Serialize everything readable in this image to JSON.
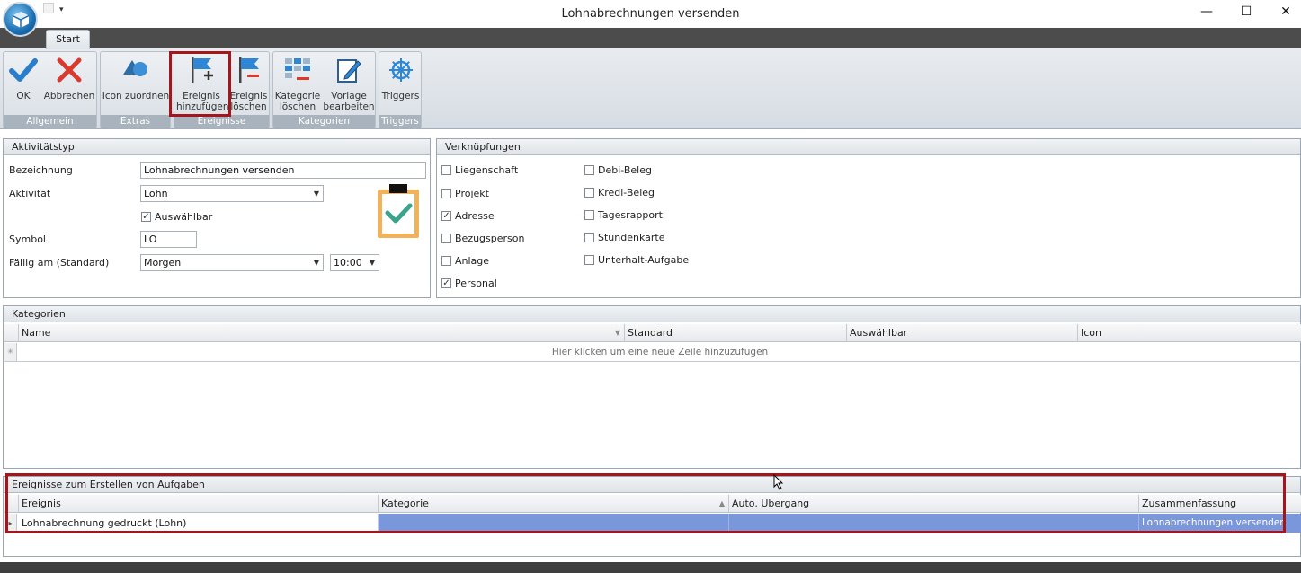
{
  "window": {
    "title": "Lohnabrechnungen versenden",
    "controls": {
      "minimize": "—",
      "maximize": "☐",
      "close": "✕"
    }
  },
  "ribbon": {
    "tab_start": "Start",
    "groups": {
      "allgemein": "Allgemein",
      "extras": "Extras",
      "ereignisse": "Ereignisse",
      "kategorien": "Kategorien",
      "triggers": "Triggers"
    },
    "buttons": {
      "ok": "OK",
      "abbrechen": "Abbrechen",
      "icon_zuordnen": "Icon zuordnen",
      "ereignis_hinzufuegen_1": "Ereignis",
      "ereignis_hinzufuegen_2": "hinzufügen",
      "ereignis_loeschen_1": "Ereignis",
      "ereignis_loeschen_2": "löschen",
      "kategorie_loeschen_1": "Kategorie",
      "kategorie_loeschen_2": "löschen",
      "vorlage_bearbeiten_1": "Vorlage",
      "vorlage_bearbeiten_2": "bearbeiten",
      "triggers": "Triggers"
    }
  },
  "aktivitaetstyp": {
    "header": "Aktivitätstyp",
    "bezeichnung_label": "Bezeichnung",
    "bezeichnung_value": "Lohnabrechnungen versenden",
    "aktivitaet_label": "Aktivität",
    "aktivitaet_value": "Lohn",
    "auswaehlbar_label": "Auswählbar",
    "auswaehlbar_checked": true,
    "symbol_label": "Symbol",
    "symbol_value": "LO",
    "faellig_label": "Fällig am (Standard)",
    "faellig_value": "Morgen",
    "time_value": "10:00"
  },
  "verknuepfungen": {
    "header": "Verknüpfungen",
    "col1": [
      {
        "label": "Liegenschaft",
        "checked": false
      },
      {
        "label": "Projekt",
        "checked": false
      },
      {
        "label": "Adresse",
        "checked": true
      },
      {
        "label": "Bezugsperson",
        "checked": false
      },
      {
        "label": "Anlage",
        "checked": false
      },
      {
        "label": "Personal",
        "checked": true
      }
    ],
    "col2": [
      {
        "label": "Debi-Beleg",
        "checked": false
      },
      {
        "label": "Kredi-Beleg",
        "checked": false
      },
      {
        "label": "Tagesrapport",
        "checked": false
      },
      {
        "label": "Stundenkarte",
        "checked": false
      },
      {
        "label": "Unterhalt-Aufgabe",
        "checked": false
      }
    ]
  },
  "kategorien": {
    "header": "Kategorien",
    "columns": [
      "Name",
      "Standard",
      "Auswählbar",
      "Icon"
    ],
    "new_row_hint": "Hier klicken um eine neue Zeile hinzuzufügen"
  },
  "ereignisse": {
    "header": "Ereignisse zum Erstellen von Aufgaben",
    "columns": [
      "Ereignis",
      "Kategorie",
      "Auto. Übergang",
      "Zusammenfassung"
    ],
    "rows": [
      {
        "ereignis": "Lohnabrechnung gedruckt (Lohn)",
        "kategorie": "",
        "auto_uebergang": "",
        "zusammenfassung": "Lohnabrechnungen versenden"
      }
    ]
  },
  "colors": {
    "highlight_border": "#a5151c",
    "selected_row": "#7b97db",
    "ok_blue": "#2a7dc9",
    "cancel_red": "#d83a2e"
  }
}
